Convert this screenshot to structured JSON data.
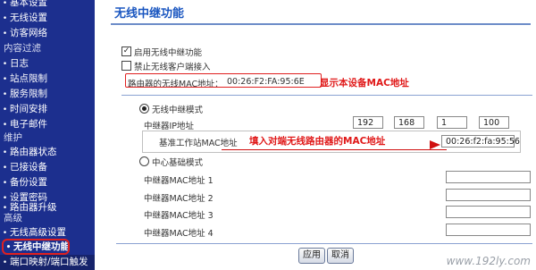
{
  "sidebar": {
    "items": [
      {
        "label": "基本设置",
        "type": "link"
      },
      {
        "label": "无线设置",
        "type": "link"
      },
      {
        "label": "访客网络",
        "type": "link"
      },
      {
        "label": "内容过滤",
        "type": "section"
      },
      {
        "label": "日志",
        "type": "link"
      },
      {
        "label": "站点限制",
        "type": "link"
      },
      {
        "label": "服务限制",
        "type": "link"
      },
      {
        "label": "时间安排",
        "type": "link"
      },
      {
        "label": "电子邮件",
        "type": "link"
      },
      {
        "label": "维护",
        "type": "section"
      },
      {
        "label": "路由器状态",
        "type": "link"
      },
      {
        "label": "已接设备",
        "type": "link"
      },
      {
        "label": "备份设置",
        "type": "link"
      },
      {
        "label": "设置密码",
        "type": "link"
      },
      {
        "label": "路由器升级",
        "type": "link"
      },
      {
        "label": "高级",
        "type": "section"
      },
      {
        "label": "无线高级设置",
        "type": "link"
      },
      {
        "label": "无线中继功能",
        "type": "link-active"
      },
      {
        "label": "端口映射/端口触发",
        "type": "link"
      }
    ]
  },
  "main": {
    "title": "无线中继功能",
    "enable_repeater": {
      "label": "启用无线中继功能",
      "checked": true
    },
    "disable_client": {
      "label": "禁止无线客户端接入",
      "checked": false
    },
    "router_mac": {
      "label": "路由器的无线MAC地址：",
      "value": "00:26:F2:FA:95:6E"
    },
    "annotation_mac": "显示本设备MAC地址",
    "repeater_mode": {
      "label": "无线中继模式",
      "selected": true,
      "ip_label": "中继器IP地址",
      "ip": [
        "192",
        "168",
        "1",
        "100"
      ],
      "base_mac_label": "基准工作站MAC地址",
      "base_mac_value": "00:26:f2:fa:95:56"
    },
    "annotation_fill": "填入对端无线路由器的MAC地址",
    "base_mode": {
      "label": "中心基础模式",
      "selected": false,
      "rows": [
        {
          "label": "中继器MAC地址 1",
          "value": ""
        },
        {
          "label": "中继器MAC地址 2",
          "value": ""
        },
        {
          "label": "中继器MAC地址 3",
          "value": ""
        },
        {
          "label": "中继器MAC地址 4",
          "value": ""
        }
      ]
    },
    "buttons": {
      "apply": "应用",
      "cancel": "取消"
    },
    "watermark": "www.192ly.com"
  },
  "colors": {
    "sidebar_bg": "#1c2f8e",
    "title": "#1a56c0",
    "annotation": "#e01818"
  }
}
